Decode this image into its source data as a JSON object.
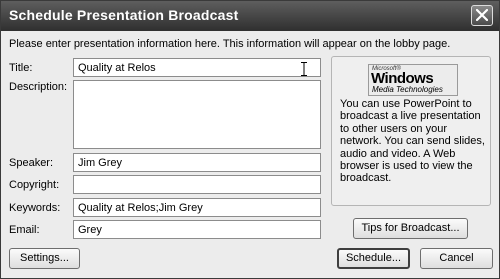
{
  "dialog": {
    "title": "Schedule Presentation Broadcast",
    "intro": "Please enter presentation information here. This information will appear on the lobby page."
  },
  "form": {
    "title_label": "Title:",
    "title_value": "Quality at Relos",
    "description_label": "Description:",
    "description_value": "",
    "speaker_label": "Speaker:",
    "speaker_value": "Jim Grey",
    "copyright_label": "Copyright:",
    "copyright_value": "",
    "keywords_label": "Keywords:",
    "keywords_value": "Quality at Relos;Jim Grey",
    "email_label": "Email:",
    "email_value": "Grey"
  },
  "windows_media": {
    "logo_microsoft": "Microsoft®",
    "logo_windows": "Windows",
    "logo_media": "Media Technologies",
    "text": "You can use PowerPoint to broadcast a live presentation to other users on your network. You can send slides, audio and video. A Web browser is used to view the broadcast."
  },
  "buttons": {
    "tips": "Tips for Broadcast...",
    "settings": "Settings...",
    "schedule": "Schedule...",
    "cancel": "Cancel"
  },
  "icons": {
    "close": "close-icon",
    "cursor": "text-cursor-icon"
  }
}
